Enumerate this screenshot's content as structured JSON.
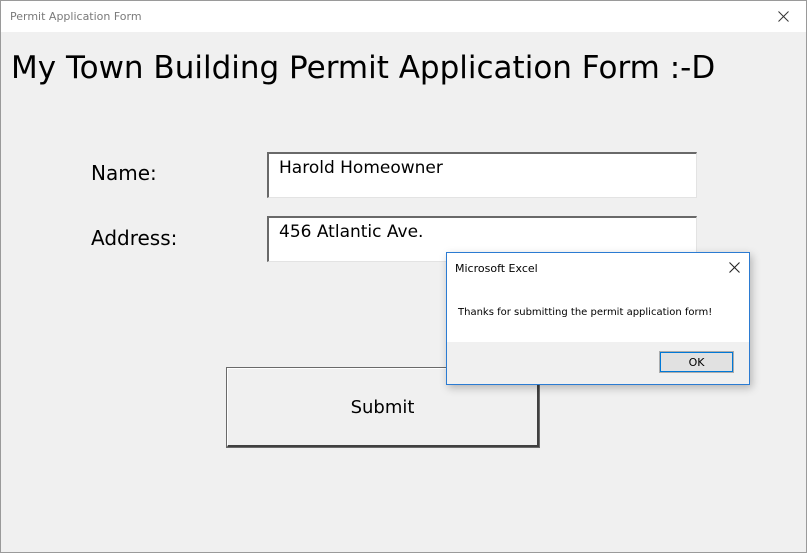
{
  "window": {
    "title": "Permit Application Form",
    "close_icon": "close-icon"
  },
  "form": {
    "heading": "My Town Building Permit Application Form :-D",
    "name_label": "Name:",
    "name_value": "Harold Homeowner",
    "address_label": "Address:",
    "address_value": "456 Atlantic Ave.",
    "submit_label": "Submit"
  },
  "dialog": {
    "title": "Microsoft Excel",
    "message": "Thanks for submitting the permit application form!",
    "ok_label": "OK",
    "close_icon": "close-icon"
  },
  "colors": {
    "dialog_border": "#2b7bd2",
    "background": "#f0f0f0"
  }
}
